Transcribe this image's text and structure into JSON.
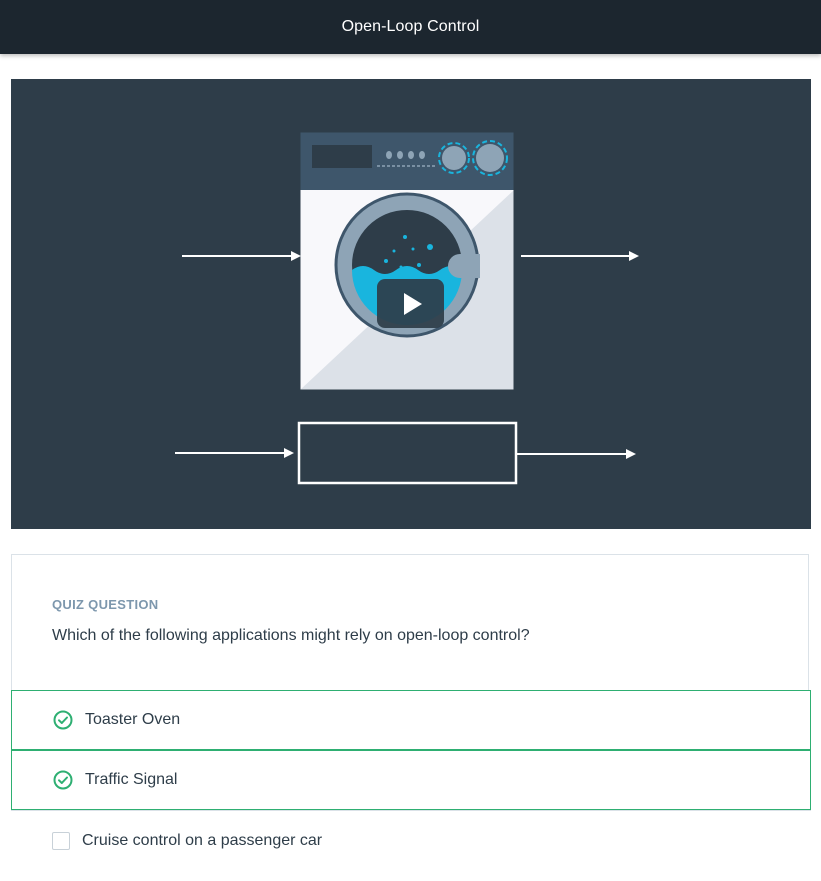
{
  "header": {
    "title": "Open-Loop Control"
  },
  "video": {
    "play_icon": "play-icon"
  },
  "quiz": {
    "label": "QUIZ QUESTION",
    "question": "Which of the following applications might rely on open-loop control?",
    "options": [
      {
        "label": "Toaster Oven",
        "selected": true
      },
      {
        "label": "Traffic Signal",
        "selected": true
      },
      {
        "label": "Cruise control on a passenger car",
        "selected": false
      }
    ]
  },
  "colors": {
    "header_bg": "#1c262f",
    "video_bg": "#2e3d49",
    "accent_green": "#2eaf72",
    "label_gray": "#7d97ad",
    "water_blue": "#19b5de"
  }
}
